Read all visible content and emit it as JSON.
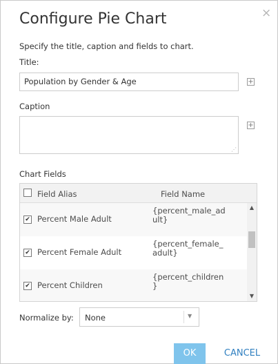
{
  "dialog": {
    "title": "Configure Pie Chart",
    "close_glyph": "×",
    "instruction": "Specify the title, caption and fields to chart."
  },
  "title_field": {
    "label": "Title:",
    "value": "Population by Gender & Age"
  },
  "caption_field": {
    "label": "Caption",
    "value": ""
  },
  "plus_glyph": "+",
  "chart_fields": {
    "label": "Chart Fields",
    "header": {
      "alias": "Field Alias",
      "name": "Field Name",
      "checked": false
    },
    "rows": [
      {
        "alias": "Percent Male Adult",
        "name": "{percent_male_ad\nult}",
        "checked": true
      },
      {
        "alias": "Percent Female Adult",
        "name": "{percent_female_\nadult}",
        "checked": true
      },
      {
        "alias": "Percent Children",
        "name": "{percent_children\n}",
        "checked": true
      }
    ],
    "scroll_fraction": 0.3
  },
  "normalize": {
    "label": "Normalize by:",
    "selected": "None"
  },
  "buttons": {
    "ok": "OK",
    "cancel": "CANCEL"
  },
  "icons": {
    "close": "close-icon",
    "plus": "plus-icon",
    "check": "check-icon",
    "dropdown": "chevron-down-icon",
    "resize": "resize-grip-icon"
  },
  "colors": {
    "ok_button": "#7fc4ec",
    "cancel_text": "#2f7fc0",
    "title_text": "#333333"
  }
}
